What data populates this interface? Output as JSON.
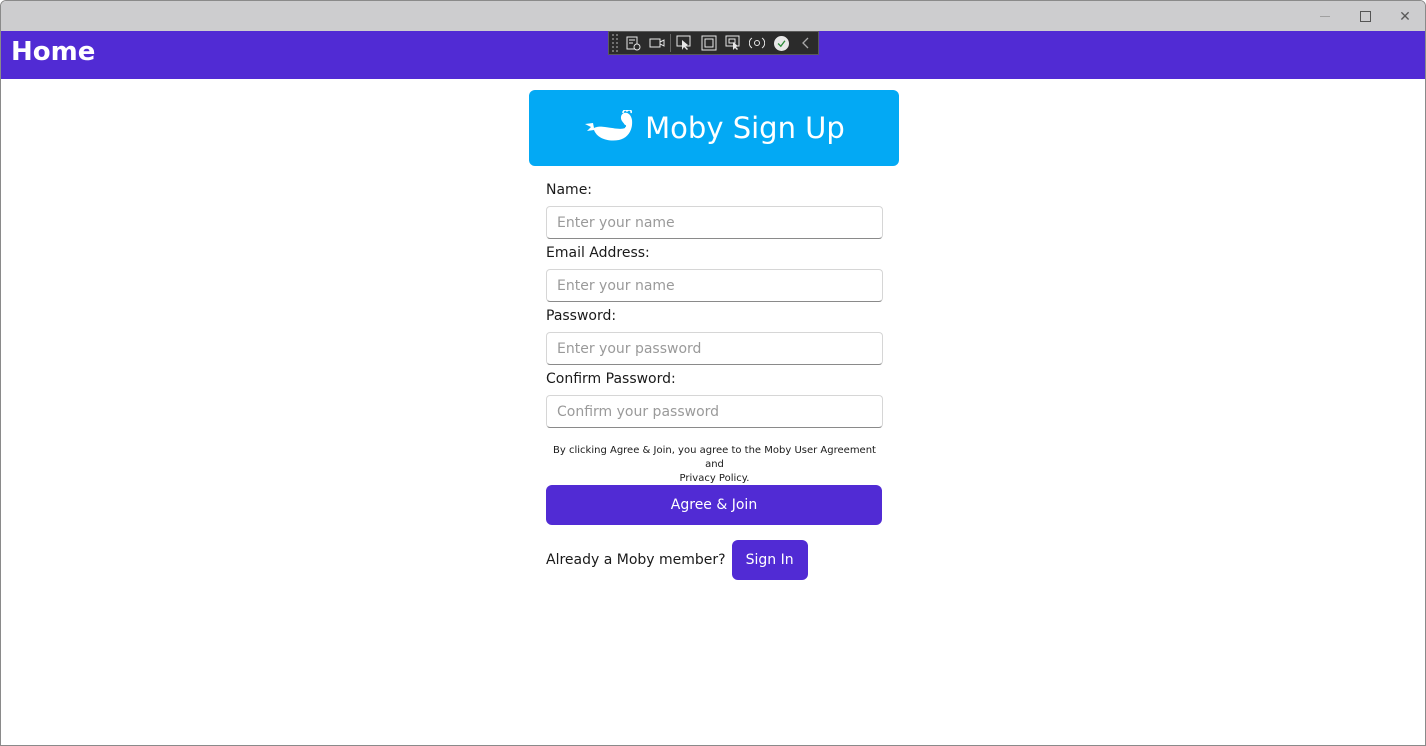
{
  "window": {
    "minimize_icon": "minimize-icon",
    "maximize_icon": "maximize-icon",
    "close_glyph": "✕"
  },
  "appbar": {
    "title": "Home",
    "color": "#512bd4"
  },
  "debug_toolbar": {
    "icons": [
      "live-visual-tree-icon",
      "record-icon",
      "select-element-icon",
      "display-adorners-icon",
      "track-focus-icon",
      "hot-reload-icon",
      "binding-check-icon",
      "collapse-icon"
    ]
  },
  "banner": {
    "logo": "whale-icon",
    "title": "Moby Sign Up",
    "color": "#03a9f4"
  },
  "form": {
    "fields": [
      {
        "label": "Name:",
        "placeholder": "Enter your name",
        "value": ""
      },
      {
        "label": "Email Address:",
        "placeholder": "Enter your name",
        "value": ""
      },
      {
        "label": "Password:",
        "placeholder": "Enter your password",
        "value": ""
      },
      {
        "label": "Confirm Password:",
        "placeholder": "Confirm your password",
        "value": ""
      }
    ],
    "legal_line1": "By clicking Agree & Join, you agree to the Moby User Agreement and",
    "legal_line2": "Privacy Policy.",
    "join_label": "Agree & Join",
    "signin_prompt": "Already a Moby member?",
    "signin_label": "Sign In"
  }
}
